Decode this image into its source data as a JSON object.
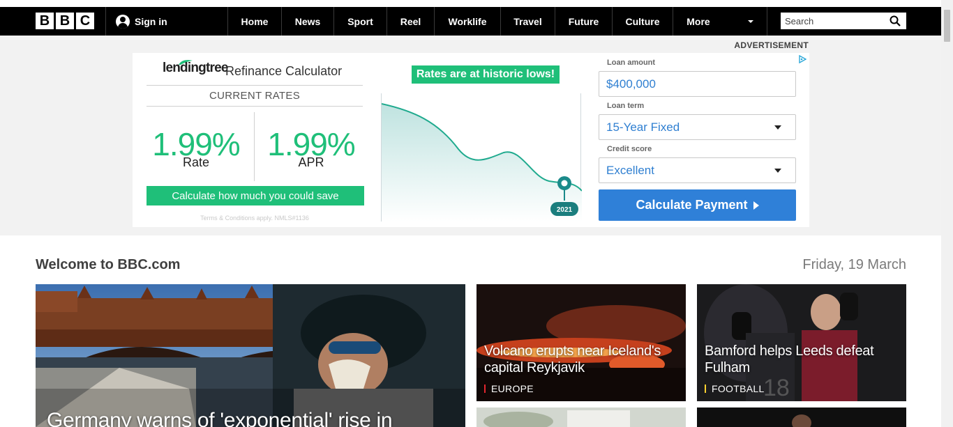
{
  "nav": {
    "logo_letters": [
      "B",
      "B",
      "C"
    ],
    "signin_label": "Sign in",
    "items": [
      "Home",
      "News",
      "Sport",
      "Reel",
      "Worklife",
      "Travel",
      "Future",
      "Culture",
      "More"
    ],
    "search_placeholder": "Search"
  },
  "advertisement": {
    "label": "ADVERTISEMENT",
    "brand": "lendingtree",
    "title": "Refinance Calculator",
    "current_rates_label": "CURRENT RATES",
    "rate_value": "1.99%",
    "rate_label": "Rate",
    "apr_value": "1.99%",
    "apr_label": "APR",
    "cta": "Calculate how much you could save",
    "terms": "Terms & Conditions apply. NMLS#1136",
    "chart_badge": "Rates are at historic lows!",
    "chart_year": "2021",
    "loan_amount_label": "Loan amount",
    "loan_amount_value": "$400,000",
    "loan_term_label": "Loan term",
    "loan_term_value": "15-Year Fixed",
    "credit_score_label": "Credit score",
    "credit_score_value": "Excellent",
    "calc_button": "Calculate Payment",
    "colors": {
      "green": "#1fbf79",
      "blue": "#2f80d8",
      "teal": "#1b8a8a"
    }
  },
  "main": {
    "welcome": "Welcome to BBC.com",
    "date": "Friday, 19 March",
    "cards": [
      {
        "title": "Germany warns of 'exponential' rise in",
        "tag": ""
      },
      {
        "title": "Volcano erupts near Iceland's capital Reykjavik",
        "tag": "EUROPE"
      },
      {
        "title": "Bamford helps Leeds defeat Fulham",
        "tag": "FOOTBALL"
      }
    ]
  }
}
